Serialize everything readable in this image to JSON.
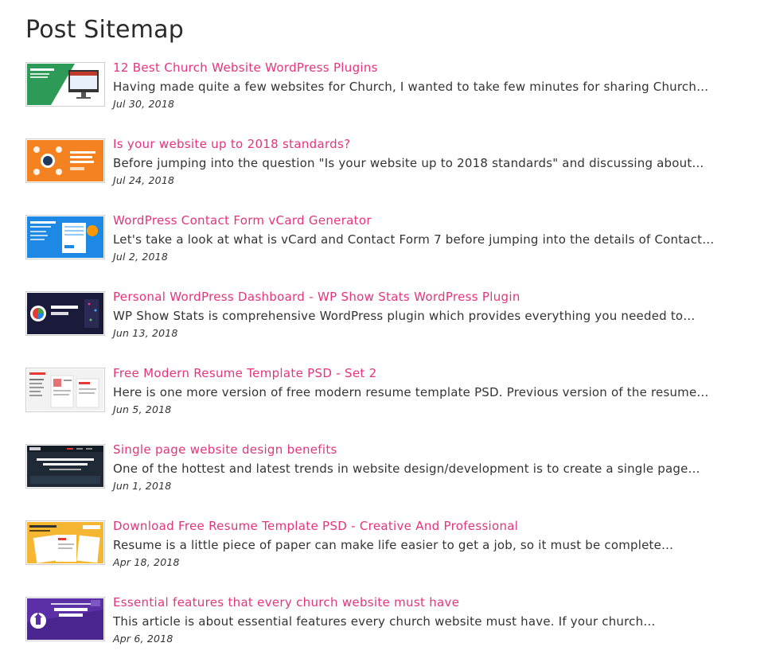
{
  "page": {
    "title": "Post Sitemap"
  },
  "posts": [
    {
      "title": "12 Best Church Website WordPress Plugins",
      "excerpt": "Having made quite a few websites for Church, I wanted to take few minutes for sharing Church…",
      "date": "Jul 30, 2018",
      "thumb_icon": "church-plugins-thumbnail",
      "thumb_color": "#2e9a58"
    },
    {
      "title": "Is your website up to 2018 standards?",
      "excerpt": "Before jumping into the question \"Is your website up to 2018 standards\" and discussing about…",
      "date": "Jul 24, 2018",
      "thumb_icon": "website-standards-thumbnail",
      "thumb_color": "#f58220"
    },
    {
      "title": "WordPress Contact Form vCard Generator",
      "excerpt": "Let's take a look at what is vCard and Contact Form 7 before jumping into the details of Contact…",
      "date": "Jul 2, 2018",
      "thumb_icon": "vcard-generator-thumbnail",
      "thumb_color": "#1e88e5"
    },
    {
      "title": "Personal WordPress Dashboard - WP Show Stats WordPress Plugin",
      "excerpt": "WP Show Stats is comprehensive WordPress plugin which provides everything you needed to…",
      "date": "Jun 13, 2018",
      "thumb_icon": "wp-show-stats-thumbnail",
      "thumb_color": "#1a1a3a"
    },
    {
      "title": "Free Modern Resume Template PSD - Set 2",
      "excerpt": "Here is one more version of free modern resume template PSD. Previous version of the resume…",
      "date": "Jun 5, 2018",
      "thumb_icon": "resume-template-thumbnail",
      "thumb_color": "#f2f2f2"
    },
    {
      "title": "Single page website design benefits",
      "excerpt": "One of the hottest and latest trends in website design/development is to create a single page…",
      "date": "Jun 1, 2018",
      "thumb_icon": "single-page-design-thumbnail",
      "thumb_color": "#1f2a36"
    },
    {
      "title": "Download Free Resume Template PSD - Creative And Professional",
      "excerpt": "Resume is a little piece of paper can make life easier to get a job, so it must be complete…",
      "date": "Apr 18, 2018",
      "thumb_icon": "creative-resume-thumbnail",
      "thumb_color": "#f5b731"
    },
    {
      "title": "Essential features that every church website must have",
      "excerpt": "This article is about essential features every church website must have. If your church…",
      "date": "Apr 6, 2018",
      "thumb_icon": "church-features-thumbnail",
      "thumb_color": "#5b2fa6"
    }
  ]
}
